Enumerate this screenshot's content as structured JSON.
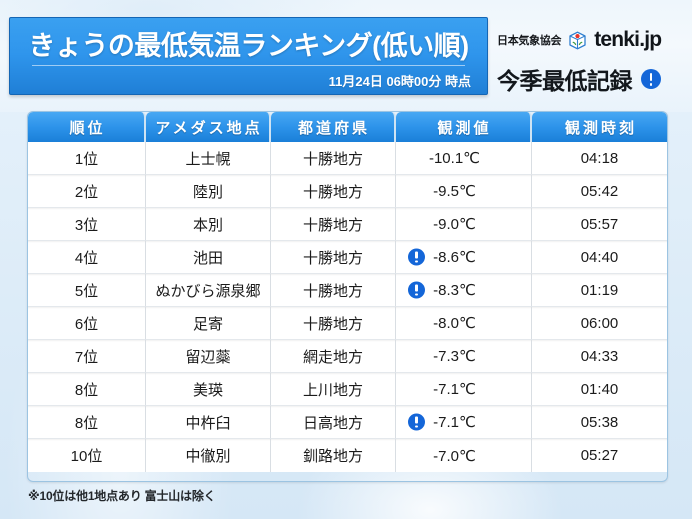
{
  "header": {
    "title": "きょうの最低気温ランキング(低い順)",
    "timestamp": "11月24日  06時00分 時点",
    "association": "日本気象協会",
    "wordmark": "tenki.jp",
    "logo_icon": "tenki-cube-logo-icon",
    "record_label": "今季最低記録",
    "record_icon": "blue-exclamation-icon",
    "accent_color": "#2f95ec",
    "alert_color": "#1466d8"
  },
  "table": {
    "columns": [
      "順位",
      "アメダス地点",
      "都道府県",
      "観測値",
      "観測時刻"
    ],
    "rows": [
      {
        "rank": "1位",
        "station": "上士幌",
        "prefecture": "十勝地方",
        "value": "-10.1℃",
        "time": "04:18",
        "record": false
      },
      {
        "rank": "2位",
        "station": "陸別",
        "prefecture": "十勝地方",
        "value": "-9.5℃",
        "time": "05:42",
        "record": false
      },
      {
        "rank": "3位",
        "station": "本別",
        "prefecture": "十勝地方",
        "value": "-9.0℃",
        "time": "05:57",
        "record": false
      },
      {
        "rank": "4位",
        "station": "池田",
        "prefecture": "十勝地方",
        "value": "-8.6℃",
        "time": "04:40",
        "record": true
      },
      {
        "rank": "5位",
        "station": "ぬかびら源泉郷",
        "prefecture": "十勝地方",
        "value": "-8.3℃",
        "time": "01:19",
        "record": true
      },
      {
        "rank": "6位",
        "station": "足寄",
        "prefecture": "十勝地方",
        "value": "-8.0℃",
        "time": "06:00",
        "record": false
      },
      {
        "rank": "7位",
        "station": "留辺蘂",
        "prefecture": "網走地方",
        "value": "-7.3℃",
        "time": "04:33",
        "record": false
      },
      {
        "rank": "8位",
        "station": "美瑛",
        "prefecture": "上川地方",
        "value": "-7.1℃",
        "time": "01:40",
        "record": false
      },
      {
        "rank": "8位",
        "station": "中杵臼",
        "prefecture": "日高地方",
        "value": "-7.1℃",
        "time": "05:38",
        "record": true
      },
      {
        "rank": "10位",
        "station": "中徹別",
        "prefecture": "釧路地方",
        "value": "-7.0℃",
        "time": "05:27",
        "record": false
      }
    ]
  },
  "footnote": "※10位は他1地点あり  富士山は除く"
}
